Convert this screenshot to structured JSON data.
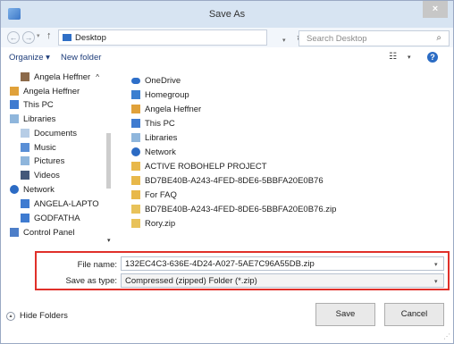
{
  "window": {
    "title": "Save As",
    "close_glyph": "×"
  },
  "nav": {
    "address": "Desktop",
    "search_placeholder": "Search Desktop"
  },
  "toolbar": {
    "organize_label": "Organize ▾",
    "new_folder_label": "New folder"
  },
  "sidebar": {
    "items": [
      {
        "label": "Angela Heffner",
        "icon": "user-folder-icon",
        "color": "#8c6a4a"
      },
      {
        "label": "Angela Heffner",
        "icon": "user-folder-icon",
        "color": "#e0a13a"
      },
      {
        "label": "This PC",
        "icon": "computer-icon",
        "color": "#3f7bd0"
      },
      {
        "label": "Libraries",
        "icon": "libraries-icon",
        "color": "#8fb6dc"
      },
      {
        "label": "Documents",
        "icon": "documents-icon",
        "color": "#b7cde6"
      },
      {
        "label": "Music",
        "icon": "music-icon",
        "color": "#5a8fd6"
      },
      {
        "label": "Pictures",
        "icon": "pictures-icon",
        "color": "#8fb6dc"
      },
      {
        "label": "Videos",
        "icon": "videos-icon",
        "color": "#44587a"
      },
      {
        "label": "Network",
        "icon": "network-icon",
        "color": "#2c6bc4"
      },
      {
        "label": "ANGELA-LAPTO",
        "icon": "computer-icon",
        "color": "#3f7bd0"
      },
      {
        "label": "GODFATHA",
        "icon": "computer-icon",
        "color": "#3f7bd0"
      },
      {
        "label": "Control Panel",
        "icon": "control-panel-icon",
        "color": "#4d7ec8"
      }
    ]
  },
  "files": {
    "items": [
      {
        "label": "OneDrive",
        "icon": "onedrive-icon",
        "color": "#2e6fc9"
      },
      {
        "label": "Homegroup",
        "icon": "homegroup-icon",
        "color": "#3a7fd0"
      },
      {
        "label": "Angela Heffner",
        "icon": "user-folder-icon",
        "color": "#e0a13a"
      },
      {
        "label": "This PC",
        "icon": "computer-icon",
        "color": "#3f7bd0"
      },
      {
        "label": "Libraries",
        "icon": "libraries-icon",
        "color": "#8fb6dc"
      },
      {
        "label": "Network",
        "icon": "network-icon",
        "color": "#2c6bc4"
      },
      {
        "label": "ACTIVE ROBOHELP PROJECT",
        "icon": "folder-icon",
        "color": "#e8b84a"
      },
      {
        "label": "BD7BE40B-A243-4FED-8DE6-5BBFA20E0B76",
        "icon": "folder-icon",
        "color": "#e8b84a"
      },
      {
        "label": "For FAQ",
        "icon": "folder-icon",
        "color": "#e8b84a"
      },
      {
        "label": "BD7BE40B-A243-4FED-8DE6-5BBFA20E0B76.zip",
        "icon": "zip-folder-icon",
        "color": "#e8c25a"
      },
      {
        "label": "Rory.zip",
        "icon": "zip-folder-icon",
        "color": "#e8c25a"
      }
    ]
  },
  "form": {
    "filename_label": "File name:",
    "filename_value": "132EC4C3-636E-4D24-A027-5AE7C96A55DB.zip",
    "type_label": "Save as type:",
    "type_value": "Compressed (zipped) Folder (*.zip)"
  },
  "footer": {
    "hide_folders_label": "Hide Folders",
    "save_label": "Save",
    "cancel_label": "Cancel"
  },
  "colors": {
    "highlight": "#e0302a",
    "link": "#1e3d7a",
    "titlebar": "#d7e4f2"
  }
}
